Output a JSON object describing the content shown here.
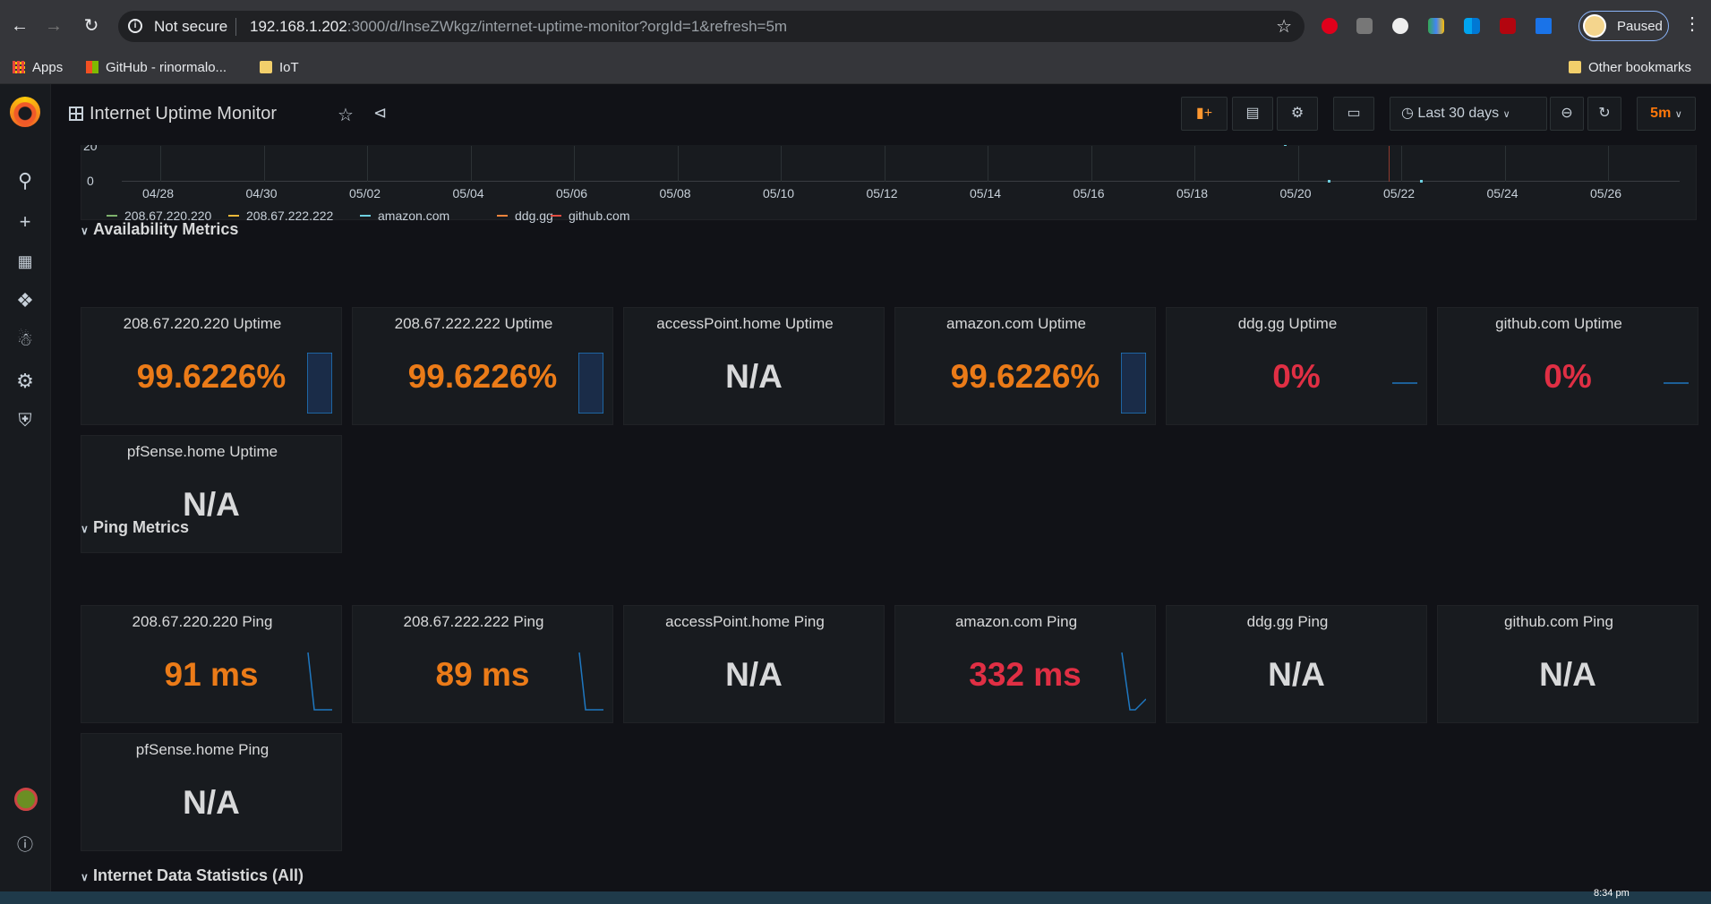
{
  "browser": {
    "security_label": "Not secure",
    "url_host": "192.168.1.202",
    "url_rest": ":3000/d/lnseZWkgz/internet-uptime-monitor?orgId=1&refresh=5m",
    "profile_label": "Paused"
  },
  "bookmarks": {
    "apps": "Apps",
    "github": "GitHub - rinormalo...",
    "iot": "IoT",
    "other": "Other bookmarks"
  },
  "dashboard": {
    "title": "Internet Uptime Monitor",
    "time_range": "Last 30 days",
    "refresh": "5m"
  },
  "graph": {
    "y_ticks": [
      "20",
      "0"
    ],
    "x_ticks": [
      "04/28",
      "04/30",
      "05/02",
      "05/04",
      "05/06",
      "05/08",
      "05/10",
      "05/12",
      "05/14",
      "05/16",
      "05/18",
      "05/20",
      "05/22",
      "05/24",
      "05/26"
    ],
    "legend": [
      {
        "name": "208.67.220.220",
        "color": "#7eb26d"
      },
      {
        "name": "208.67.222.222",
        "color": "#eab839"
      },
      {
        "name": "amazon.com",
        "color": "#6ed0e0"
      },
      {
        "name": "ddg.gg",
        "color": "#ef843c"
      },
      {
        "name": "github.com",
        "color": "#e24d42"
      }
    ]
  },
  "rows": {
    "availability": "Availability Metrics",
    "ping": "Ping Metrics",
    "internet": "Internet Data Statistics (All)"
  },
  "availability": [
    {
      "title": "208.67.220.220 Uptime",
      "value": "99.6226%",
      "level": "orange"
    },
    {
      "title": "208.67.222.222 Uptime",
      "value": "99.6226%",
      "level": "orange"
    },
    {
      "title": "accessPoint.home Uptime",
      "value": "N/A",
      "level": "gray"
    },
    {
      "title": "amazon.com Uptime",
      "value": "99.6226%",
      "level": "orange"
    },
    {
      "title": "ddg.gg Uptime",
      "value": "0%",
      "level": "red"
    },
    {
      "title": "github.com Uptime",
      "value": "0%",
      "level": "red"
    },
    {
      "title": "pfSense.home Uptime",
      "value": "N/A",
      "level": "gray"
    }
  ],
  "ping": [
    {
      "title": "208.67.220.220 Ping",
      "value": "91 ms",
      "level": "orange"
    },
    {
      "title": "208.67.222.222 Ping",
      "value": "89 ms",
      "level": "orange"
    },
    {
      "title": "accessPoint.home Ping",
      "value": "N/A",
      "level": "gray"
    },
    {
      "title": "amazon.com Ping",
      "value": "332 ms",
      "level": "red"
    },
    {
      "title": "ddg.gg Ping",
      "value": "N/A",
      "level": "gray"
    },
    {
      "title": "github.com Ping",
      "value": "N/A",
      "level": "gray"
    },
    {
      "title": "pfSense.home Ping",
      "value": "N/A",
      "level": "gray"
    }
  ],
  "taskbar": {
    "time": "8:34 pm"
  }
}
